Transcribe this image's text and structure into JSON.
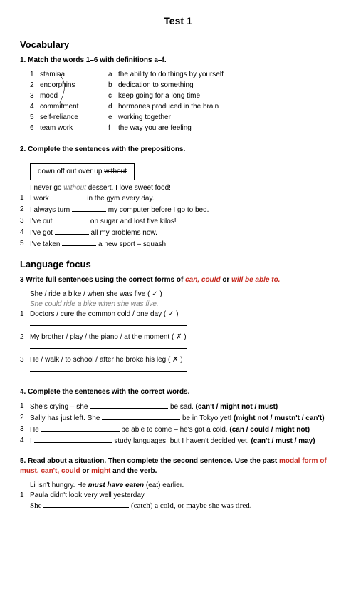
{
  "title": "Test 1",
  "vocab_heading": "Vocabulary",
  "q1": {
    "instr": "1.  Match the words 1–6 with definitions a–f.",
    "left": [
      {
        "n": "1",
        "w": "stamina"
      },
      {
        "n": "2",
        "w": "endorphins"
      },
      {
        "n": "3",
        "w": "mood"
      },
      {
        "n": "4",
        "w": "commitment"
      },
      {
        "n": "5",
        "w": "self-reliance"
      },
      {
        "n": "6",
        "w": "team work"
      }
    ],
    "right": [
      {
        "l": "a",
        "d": "the ability to do things by yourself"
      },
      {
        "l": "b",
        "d": "dedication to something"
      },
      {
        "l": "c",
        "d": "keep going for a long time"
      },
      {
        "l": "d",
        "d": "hormones produced in the brain"
      },
      {
        "l": "e",
        "d": "working together"
      },
      {
        "l": "f",
        "d": "the way you are feeling"
      }
    ]
  },
  "q2": {
    "instr": "2.   Complete the sentences with the prepositions.",
    "box_words": "down   off   out   over   up   ",
    "box_struck": "without",
    "example_pre": "I never go ",
    "example_word": "without",
    "example_post": " dessert. I love sweet food!",
    "items": [
      {
        "n": "1",
        "pre": "I work ",
        "post": " in the gym every day."
      },
      {
        "n": "2",
        "pre": "I always turn ",
        "post": " my computer before I go to bed."
      },
      {
        "n": "3",
        "pre": "I've cut ",
        "post": " on sugar and lost five kilos!"
      },
      {
        "n": "4",
        "pre": "I've got ",
        "post": " all my problems now."
      },
      {
        "n": "5",
        "pre": "I've taken ",
        "post": " a new sport – squash."
      }
    ]
  },
  "lang_heading": "Language focus",
  "q3": {
    "instr_pre": "3   Write full sentences using the correct forms of ",
    "instr_red": "can, could ",
    "instr_or": "or ",
    "instr_red2": "will be able to.",
    "example_prompt": "She / ride a bike / when she was five ( ✓ )",
    "example_answer": "She could ride a bike when she was five.",
    "items": [
      {
        "n": "1",
        "t": "Doctors / cure the common cold / one day ( ✓ )"
      },
      {
        "n": "2",
        "t": "My brother / play / the piano / at the moment ( ✗ )"
      },
      {
        "n": "3",
        "t": "He / walk / to school / after he broke his leg ( ✗ )"
      }
    ]
  },
  "q4": {
    "instr": "4.   Complete the sentences with the correct words.",
    "items": [
      {
        "n": "1",
        "pre": "She's crying – she ",
        "post": " be sad. ",
        "opts": "(can't / might not / must)"
      },
      {
        "n": "2",
        "pre": "Sally has just left. She ",
        "post": " be in Tokyo yet! ",
        "opts": "(might not / mustn't / can't)"
      },
      {
        "n": "3",
        "pre": "He ",
        "post": " be able to come – he's got a cold. ",
        "opts": "(can / could / might not)"
      },
      {
        "n": "4",
        "pre": "I ",
        "post": " study languages, but I haven't decided yet. ",
        "opts": "(can't / must / may)"
      }
    ]
  },
  "q5": {
    "instr_pre": "5.   Read about a situation. Then complete the second sentence. Use the past ",
    "instr_red1": "modal form of must, can't, could ",
    "instr_or": "or ",
    "instr_red2": "might ",
    "instr_post": "and the verb.",
    "ex_line1_pre": "Li isn't hungry. He ",
    "ex_line1_bold": "must have eaten",
    "ex_line1_post": " (eat) earlier.",
    "item1_n": "1",
    "item1_line1": "Paula didn't look very well yesterday.",
    "item1_line2_pre": "She ",
    "item1_line2_post": " (catch) a cold, or maybe she was tired."
  }
}
